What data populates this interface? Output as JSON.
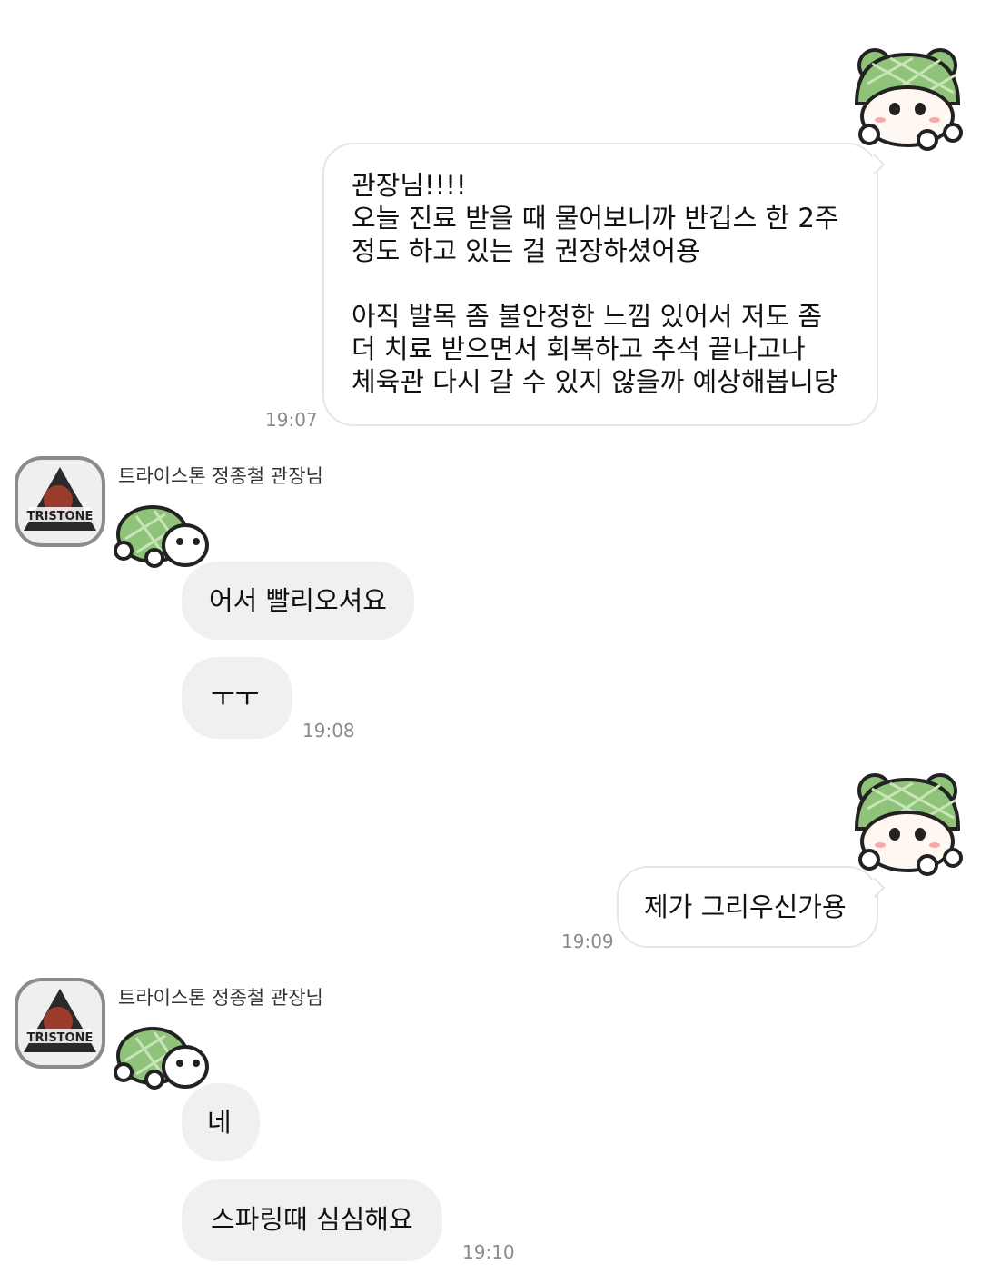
{
  "messages": {
    "m1": {
      "lines": [
        "관장님!!!!",
        "오늘 진료 받을 때 물어보니까 반깁스 한 2주",
        "정도 하고 있는 걸 권장하셨어용",
        "",
        "아직 발목 좀 불안정한 느낌 있어서 저도 좀",
        "더 치료 받으면서 회복하고 추석 끝나고나",
        "체육관 다시 갈 수 있지 않을까 예상해봅니당"
      ],
      "time": "19:07"
    },
    "g1": {
      "sender": "트라이스톤 정종철 관장님",
      "avatar_text": "TRISTONE",
      "m2": "어서 빨리오셔요",
      "m3": "ㅜㅜ",
      "time": "19:08"
    },
    "m4": {
      "text": "제가 그리우신가용",
      "time": "19:09"
    },
    "g2": {
      "sender": "트라이스톤 정종철 관장님",
      "avatar_text": "TRISTONE",
      "m5": "네",
      "m6": "스파링때 심심해요",
      "time": "19:10"
    }
  },
  "colors": {
    "incoming_bubble": "#f0f0f0",
    "outgoing_border": "#e6e6e6",
    "sticker_green": "#8fc37a",
    "time_text": "#8a8a8a"
  },
  "icons": {
    "outgoing_sticker": "frog-hat-character-sticker",
    "incoming_sticker": "turtle-sticker"
  }
}
